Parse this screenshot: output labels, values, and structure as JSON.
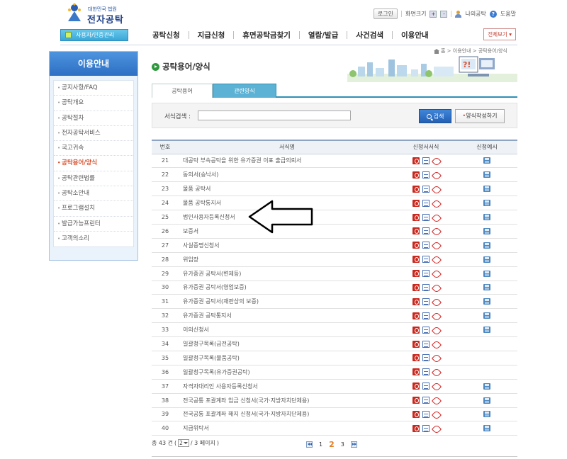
{
  "header": {
    "logo_sub": "대한민국 법원",
    "logo_title": "전자공탁",
    "login_label": "로그인",
    "zoom_label": "화면크기",
    "zoom_in": "+",
    "zoom_out": "-",
    "mypage_label": "나의공탁",
    "help_label": "도움말"
  },
  "gnb": {
    "user_button": "사용자/인증관리",
    "menu": [
      "공탁신청",
      "지급신청",
      "휴면공탁금찾기",
      "열람/발급",
      "사건검색",
      "이용안내"
    ],
    "all_view": "전체보기"
  },
  "lnb": {
    "title": "이용안내",
    "items": [
      {
        "label": "공지사항/FAQ",
        "active": false
      },
      {
        "label": "공탁개요",
        "active": false
      },
      {
        "label": "공탁절차",
        "active": false
      },
      {
        "label": "전자공탁서비스",
        "active": false
      },
      {
        "label": "국고귀속",
        "active": false
      },
      {
        "label": "공탁용어/양식",
        "active": true
      },
      {
        "label": "공탁관련법률",
        "active": false
      },
      {
        "label": "공탁소안내",
        "active": false
      },
      {
        "label": "프로그램설치",
        "active": false
      },
      {
        "label": "발급가능프린터",
        "active": false
      },
      {
        "label": "고객의소리",
        "active": false
      }
    ]
  },
  "breadcrumb": "홈 > 이용안내 > 공탁용어/양식",
  "page_title": "공탁용어/양식",
  "tabs": [
    "공탁용어",
    "관련양식"
  ],
  "search": {
    "label": "서식검색 :",
    "value": "",
    "button": "검색",
    "write_button": "양식작성하기"
  },
  "table": {
    "headers": [
      "번호",
      "서식명",
      "신청서서식",
      "신청예시"
    ],
    "rows": [
      {
        "num": "21",
        "name": "대공탁 부속공탁을 위한 유가증권 이표 출급의뢰서",
        "example": true
      },
      {
        "num": "22",
        "name": "동의서(승낙서)",
        "example": true
      },
      {
        "num": "23",
        "name": "물품 공탁서",
        "example": true
      },
      {
        "num": "24",
        "name": "물품 공탁통지서",
        "example": true
      },
      {
        "num": "25",
        "name": "법인사용자등록신청서",
        "example": true
      },
      {
        "num": "26",
        "name": "보증서",
        "example": true
      },
      {
        "num": "27",
        "name": "사실증명신청서",
        "example": true
      },
      {
        "num": "28",
        "name": "위임장",
        "example": true
      },
      {
        "num": "29",
        "name": "유가증권 공탁서(변제등)",
        "example": true
      },
      {
        "num": "30",
        "name": "유가증권 공탁서(영업보증)",
        "example": true
      },
      {
        "num": "31",
        "name": "유가증권 공탁서(재판상의 보증)",
        "example": true
      },
      {
        "num": "32",
        "name": "유가증권 공탁통지서",
        "example": true
      },
      {
        "num": "33",
        "name": "이의신청서",
        "example": true
      },
      {
        "num": "34",
        "name": "일괄청구목록(금전공탁)",
        "example": false
      },
      {
        "num": "35",
        "name": "일괄청구목록(물품공탁)",
        "example": false
      },
      {
        "num": "36",
        "name": "일괄청구목록(유가증권공탁)",
        "example": false
      },
      {
        "num": "37",
        "name": "자격자대리인 사용자등록신청서",
        "example": true
      },
      {
        "num": "38",
        "name": "전국공통 포괄계좌 입금 신청서(국가·지방자치단체용)",
        "example": true
      },
      {
        "num": "39",
        "name": "전국공통 포괄계좌 해지 신청서(국가·지방자치단체용)",
        "example": true
      },
      {
        "num": "40",
        "name": "지급위탁서",
        "example": true
      }
    ]
  },
  "paging": {
    "total_prefix": "총 43 건",
    "page_value": "2",
    "page_suffix": "/ 3 페이지",
    "pages": [
      "1",
      "2",
      "3"
    ],
    "current": "2"
  },
  "colors": {
    "accent_blue": "#2d6fc4",
    "active_menu": "#d9502c",
    "tab_blue": "#5bb2d4"
  }
}
